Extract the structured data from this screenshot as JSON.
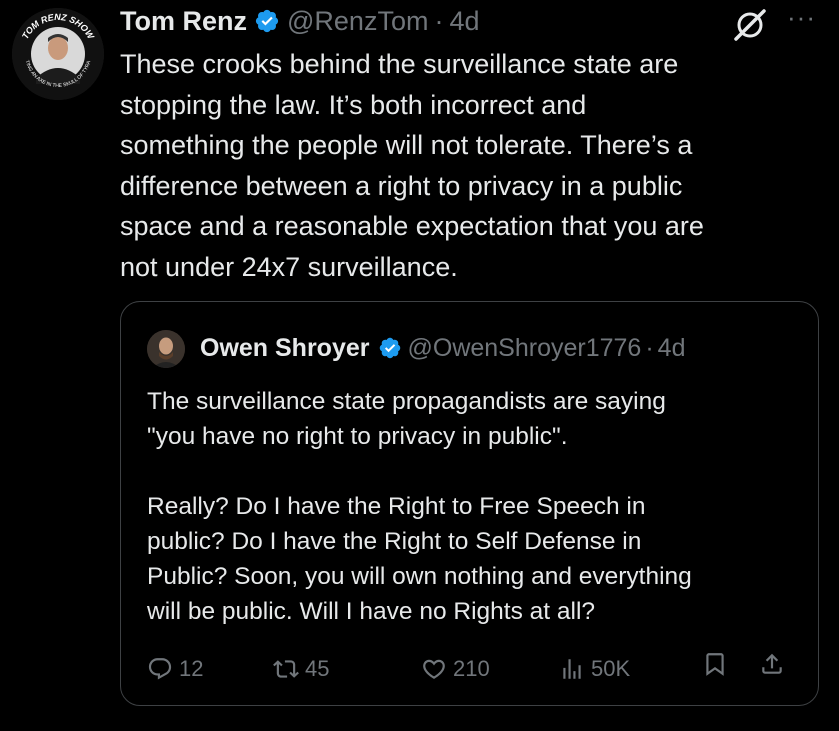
{
  "tweet": {
    "author_name": "Tom Renz",
    "author_handle": "@RenzTom",
    "separator": "·",
    "time": "4d",
    "avatar_text": "TOM RENZ SHOW",
    "avatar_subtext": "PUTTING AN AXE IN THE SKULL OF TYRANNY",
    "more_label": "···",
    "text": "These crooks behind the surveillance state are\nstopping the law. It’s both incorrect and\nsomething the people will not tolerate. There’s a\ndifference between a right to privacy in a public\nspace and a reasonable expectation that you are\nnot under 24x7 surveillance."
  },
  "quote": {
    "author_name": "Owen Shroyer",
    "author_handle": "@OwenShroyer1776",
    "separator": "·",
    "time": "4d",
    "text": "The surveillance state propagandists are saying\n\"you have no right to privacy in public\".\n\nReally? Do I have the Right to Free Speech in\npublic? Do I have the Right to Self Defense in\nPublic? Soon, you will own nothing and everything\nwill be public. Will I have no Rights at all?",
    "actions": {
      "replies": "12",
      "reposts": "45",
      "likes": "210",
      "views": "50K"
    }
  },
  "colors": {
    "background": "#000000",
    "text": "#e7e9ea",
    "muted": "#71767b",
    "verified": "#1d9bf0",
    "border": "#3e4144"
  },
  "icons": [
    "verified-badge-icon",
    "grok-icon",
    "more-icon",
    "reply-icon",
    "repost-icon",
    "like-icon",
    "views-icon",
    "bookmark-icon",
    "share-icon"
  ]
}
